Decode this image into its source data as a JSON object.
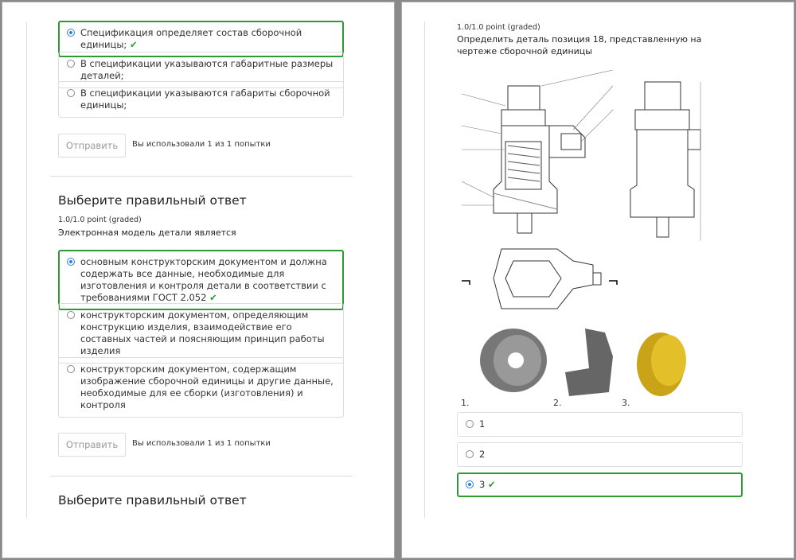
{
  "left": {
    "q1_options": [
      {
        "label": "Спецификация определяет состав сборочной единицы;",
        "selected": true,
        "correct": true
      },
      {
        "label": "В спецификации указываются габаритные размеры деталей;",
        "selected": false
      },
      {
        "label": "В спецификации указываются габариты сборочной единицы;",
        "selected": false
      }
    ],
    "submit_label": "Отправить",
    "attempts": "Вы использовали 1 из 1 попытки",
    "q2": {
      "heading": "Выберите правильный ответ",
      "points": "1.0/1.0 point (graded)",
      "prompt": "Электронная модель детали является",
      "options": [
        {
          "label": "основным конструкторским документом и должна содержать все данные, необходимые для изготовления и контроля детали в соответствии с требованиями ГОСТ 2.052",
          "selected": true,
          "correct": true
        },
        {
          "label": "конструкторским документом, определяющим конструкцию изделия, взаимодействие его составных частей и поясняющим принцип работы изделия",
          "selected": false
        },
        {
          "label": "конструкторским документом, содержащим изображение сборочной единицы и другие данные, необходимые для ее сборки (изготовления) и контроля",
          "selected": false
        }
      ]
    },
    "q3_heading": "Выберите правильный ответ"
  },
  "right": {
    "points": "1.0/1.0 point (graded)",
    "prompt": "Определить деталь позиция 18, представленную на чертеже сборочной единицы",
    "image_labels": [
      "1.",
      "2.",
      "3."
    ],
    "options": [
      {
        "label": "1"
      },
      {
        "label": "2"
      },
      {
        "label": "3",
        "selected": true,
        "correct": true
      }
    ]
  },
  "icons": {
    "check": "✔"
  },
  "colors": {
    "correct": "#2e9a33",
    "radio": "#2a7fe0"
  }
}
